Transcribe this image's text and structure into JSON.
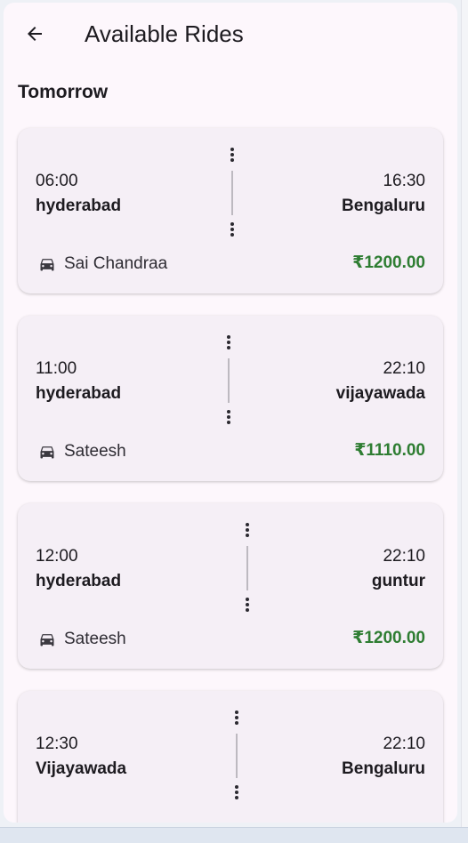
{
  "appbar": {
    "title": "Available Rides",
    "back_icon": "arrow-left-icon"
  },
  "section": {
    "title": "Tomorrow"
  },
  "rides": [
    {
      "departure_time": "06:00",
      "origin": "hyderabad",
      "arrival_time": "16:30",
      "destination": "Bengaluru",
      "driver": "Sai Chandraa",
      "price": "₹1200.00"
    },
    {
      "departure_time": "11:00",
      "origin": "hyderabad",
      "arrival_time": "22:10",
      "destination": "vijayawada",
      "driver": "Sateesh",
      "price": "₹1110.00"
    },
    {
      "departure_time": "12:00",
      "origin": "hyderabad",
      "arrival_time": "22:10",
      "destination": "guntur",
      "driver": "Sateesh",
      "price": "₹1200.00"
    },
    {
      "departure_time": "12:30",
      "origin": "Vijayawada",
      "arrival_time": "22:10",
      "destination": "Bengaluru",
      "driver": "",
      "price": ""
    }
  ],
  "colors": {
    "background": "#fdf7fc",
    "card": "#f5eff6",
    "price": "#2e7d32",
    "text": "#1d1b20"
  }
}
